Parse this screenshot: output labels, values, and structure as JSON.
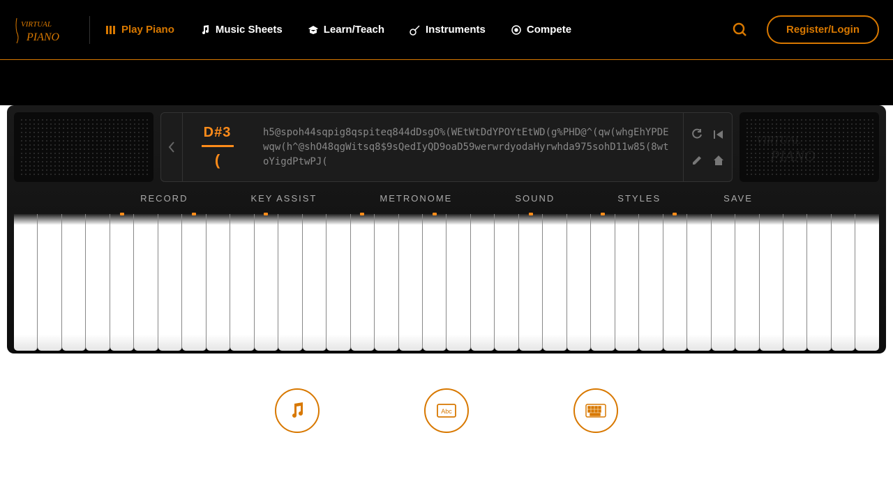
{
  "brand": {
    "name": "VIRTUAL PIANO"
  },
  "nav": {
    "play": "Play Piano",
    "sheets": "Music Sheets",
    "learn": "Learn/Teach",
    "instruments": "Instruments",
    "compete": "Compete"
  },
  "auth": {
    "register": "Register/Login"
  },
  "display": {
    "note": "D#3",
    "note_char": "(",
    "sequence": "h5@spoh44sqpig8qspiteq844dDsgO%(WEtWtDdYPOYtEtWD(g%PHD@^(qw(whgEhYPDEwqw(h^@shO48qgWitsq8$9sQedIyQD9oaD59werwrdyodaHyrwhda975sohD11w85(8wtoYigdPtwPJ("
  },
  "toolbar": {
    "record": "RECORD",
    "key_assist": "KEY ASSIST",
    "metronome": "METRONOME",
    "sound": "SOUND",
    "styles": "STYLES",
    "save": "SAVE"
  },
  "keyboard": {
    "white_key_count": 36,
    "indicator_white_keys": [
      4,
      7,
      10,
      14,
      17,
      21,
      24,
      27
    ]
  },
  "features": {
    "music": "music-notes",
    "abc": "abc-key",
    "keyboard": "keyboard"
  },
  "icons": {
    "play": "piano-bars-icon",
    "sheets": "music-note-icon",
    "learn": "graduation-cap-icon",
    "instruments": "guitar-icon",
    "compete": "target-icon",
    "search": "search-icon",
    "back": "chevron-left-icon",
    "restart": "restart-icon",
    "rewind": "skip-back-icon",
    "edit": "pencil-icon",
    "home": "home-icon"
  }
}
